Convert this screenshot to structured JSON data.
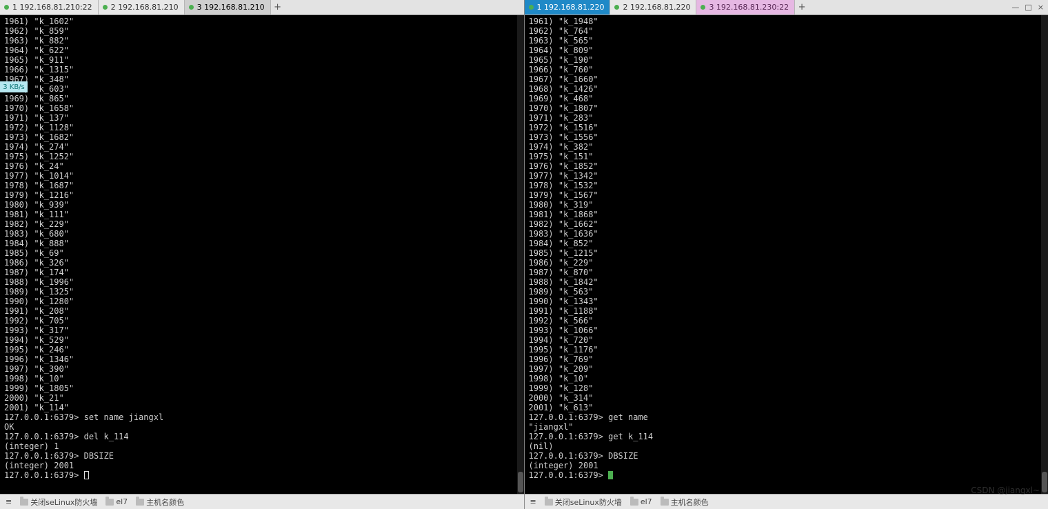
{
  "left": {
    "tabs": [
      {
        "label": "1 192.168.81.210:22",
        "active": false,
        "cls": ""
      },
      {
        "label": "2 192.168.81.210",
        "active": false,
        "cls": ""
      },
      {
        "label": "3 192.168.81.210",
        "active": true,
        "cls": "active-left"
      }
    ],
    "key_start": 1961,
    "keys": [
      "k_1602",
      "k_859",
      "k_882",
      "k_622",
      "k_911",
      "k_1315",
      "k_348",
      "k_603",
      "k_865",
      "k_1658",
      "k_137",
      "k_1128",
      "k_1682",
      "k_274",
      "k_1252",
      "k_24",
      "k_1014",
      "k_1687",
      "k_1216",
      "k_939",
      "k_111",
      "k_229",
      "k_680",
      "k_888",
      "k_69",
      "k_326",
      "k_174",
      "k_1996",
      "k_1325",
      "k_1280",
      "k_208",
      "k_705",
      "k_317",
      "k_529",
      "k_246",
      "k_1346",
      "k_390",
      "k_10",
      "k_1805",
      "k_21",
      "k_114"
    ],
    "tail": [
      "127.0.0.1:6379> set name jiangxl",
      "OK",
      "127.0.0.1:6379> del k_114",
      "(integer) 1",
      "127.0.0.1:6379> DBSIZE",
      "(integer) 2001",
      "127.0.0.1:6379> "
    ],
    "cursor": "white",
    "status": [
      {
        "icon": "hamburger"
      },
      {
        "icon": "folder",
        "label": "关闭seLinux防火墙"
      },
      {
        "icon": "folder",
        "label": "el7"
      },
      {
        "icon": "folder",
        "label": "主机名颜色"
      }
    ]
  },
  "right": {
    "tabs": [
      {
        "label": "1 192.168.81.220",
        "active": true,
        "cls": "active-blue"
      },
      {
        "label": "2 192.168.81.220",
        "active": false,
        "cls": ""
      },
      {
        "label": "3 192.168.81.230:22",
        "active": false,
        "cls": "tab-pink"
      }
    ],
    "key_start": 1961,
    "keys": [
      "k_1948",
      "k_764",
      "k_565",
      "k_809",
      "k_190",
      "k_760",
      "k_1660",
      "k_1426",
      "k_468",
      "k_1807",
      "k_283",
      "k_1516",
      "k_1556",
      "k_382",
      "k_151",
      "k_1852",
      "k_1342",
      "k_1532",
      "k_1567",
      "k_319",
      "k_1868",
      "k_1662",
      "k_1636",
      "k_852",
      "k_1215",
      "k_229",
      "k_870",
      "k_1842",
      "k_563",
      "k_1343",
      "k_1188",
      "k_566",
      "k_1066",
      "k_720",
      "k_1176",
      "k_769",
      "k_209",
      "k_10",
      "k_128",
      "k_314",
      "k_613"
    ],
    "tail": [
      "127.0.0.1:6379> get name",
      "\"jiangxl\"",
      "127.0.0.1:6379> get k_114",
      "(nil)",
      "127.0.0.1:6379> DBSIZE",
      "(integer) 2001",
      "127.0.0.1:6379> "
    ],
    "cursor": "green",
    "status": [
      {
        "icon": "hamburger"
      },
      {
        "icon": "folder",
        "label": "关闭seLinux防火墙"
      },
      {
        "icon": "folder",
        "label": "el7"
      },
      {
        "icon": "folder",
        "label": "主机名颜色"
      }
    ]
  },
  "badge": "3 KB/s",
  "watermark": "CSDN @jiangxl~",
  "win_controls": [
    "—",
    "□",
    "×"
  ]
}
